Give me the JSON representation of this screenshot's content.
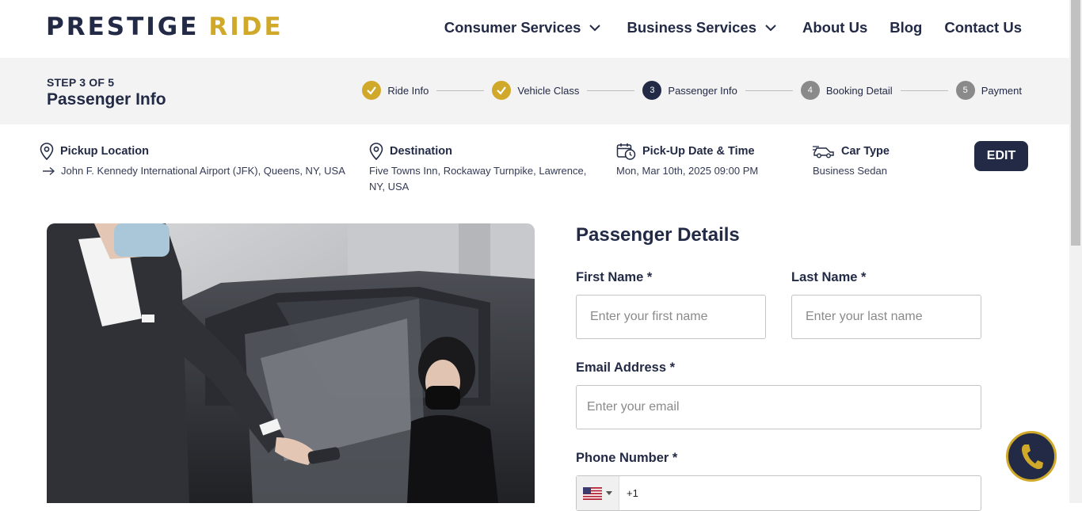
{
  "brand": {
    "part1": "PRESTIGE",
    "part2": "RIDE",
    "dark": "#222a45",
    "gold": "#d0a92b"
  },
  "nav": {
    "consumer": "Consumer Services",
    "business": "Business Services",
    "about": "About Us",
    "blog": "Blog",
    "contact": "Contact Us"
  },
  "stepbar": {
    "step_of": "STEP 3 OF 5",
    "title": "Passenger Info",
    "steps": [
      {
        "label": "Ride Info",
        "state": "done",
        "num": ""
      },
      {
        "label": "Vehicle Class",
        "state": "done",
        "num": ""
      },
      {
        "label": "Passenger Info",
        "state": "current",
        "num": "3"
      },
      {
        "label": "Booking Detail",
        "state": "todo",
        "num": "4"
      },
      {
        "label": "Payment",
        "state": "todo",
        "num": "5"
      }
    ]
  },
  "summary": {
    "pickup_head": "Pickup Location",
    "pickup_val": "John F. Kennedy International Airport (JFK), Queens, NY, USA",
    "dest_head": "Destination",
    "dest_val_1": "Five Towns Inn, Rockaway Turnpike, Lawrence,",
    "dest_val_2": "NY, USA",
    "date_head": "Pick-Up Date & Time",
    "date_val": "Mon, Mar 10th, 2025 09:00 PM",
    "car_head": "Car Type",
    "car_val": "Business Sedan",
    "edit": "EDIT"
  },
  "form": {
    "title": "Passenger Details",
    "first_label": "First Name *",
    "first_ph": "Enter your first name",
    "last_label": "Last Name *",
    "last_ph": "Enter your last name",
    "email_label": "Email Address *",
    "email_ph": "Enter your email",
    "phone_label": "Phone Number *",
    "phone_code": "+1"
  }
}
